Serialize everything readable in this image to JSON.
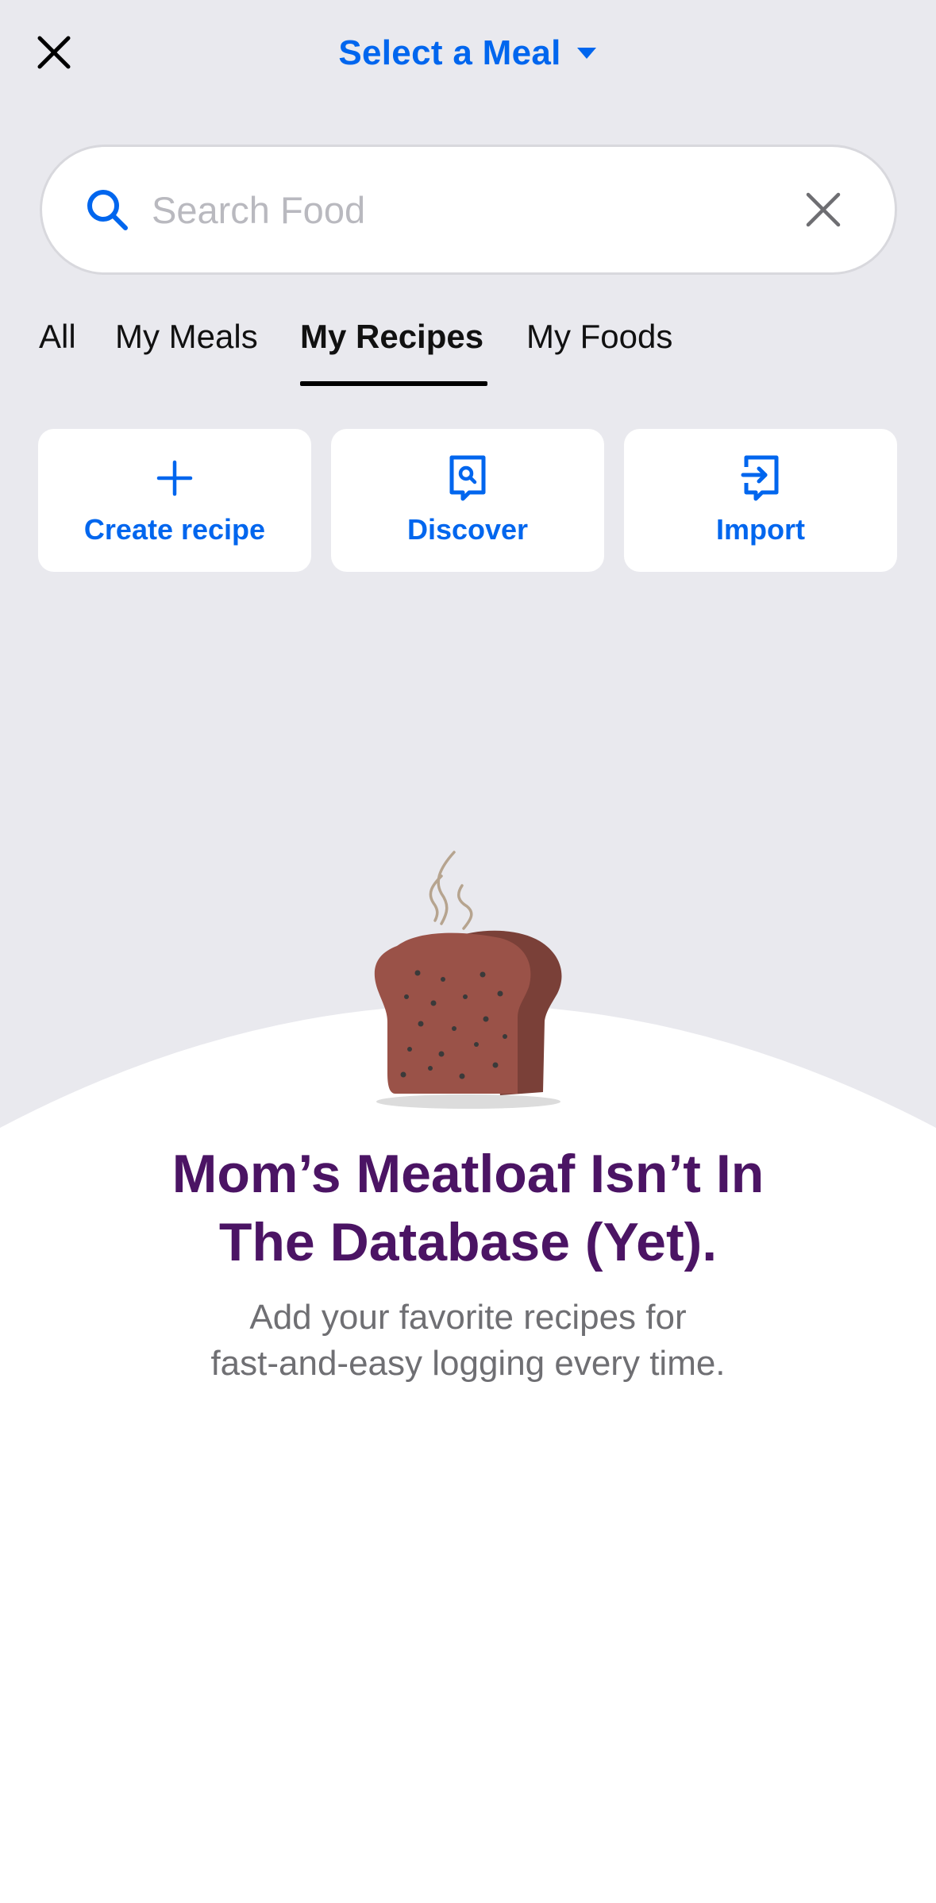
{
  "header": {
    "close_icon": "close-icon",
    "meal_select_label": "Select a Meal",
    "dropdown_icon": "caret-down-icon"
  },
  "search": {
    "placeholder": "Search Food",
    "value": "",
    "search_icon": "search-icon",
    "clear_icon": "clear-icon"
  },
  "tabs": [
    {
      "label": "All",
      "active": false
    },
    {
      "label": "My Meals",
      "active": false
    },
    {
      "label": "My Recipes",
      "active": true
    },
    {
      "label": "My Foods",
      "active": false
    }
  ],
  "actions": [
    {
      "label": "Create recipe",
      "icon": "plus-icon"
    },
    {
      "label": "Discover",
      "icon": "discover-icon"
    },
    {
      "label": "Import",
      "icon": "import-icon"
    }
  ],
  "empty_state": {
    "illustration": "meatloaf-illustration",
    "title_line1": "Mom’s Meatloaf Isn’t In",
    "title_line2": "The Database (Yet).",
    "subtitle_line1": "Add your favorite recipes for",
    "subtitle_line2": "fast-and-easy logging every time."
  },
  "colors": {
    "accent": "#0066EE",
    "background": "#E9E9EE",
    "title": "#4B1464",
    "subtitle": "#6F6F73",
    "card": "#FFFFFF"
  }
}
